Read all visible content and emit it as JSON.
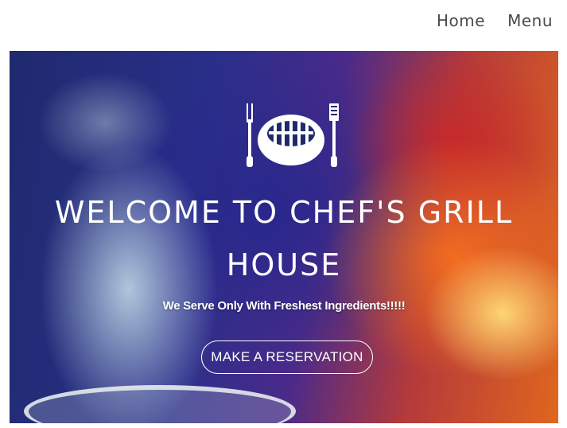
{
  "nav": {
    "items": [
      {
        "label": "Home"
      },
      {
        "label": "Menu"
      }
    ]
  },
  "hero": {
    "logo_icon": "grill-logo-icon",
    "title": "WELCOME TO CHEF'S GRILL HOUSE",
    "subtitle": "We Serve Only With Freshest Ingredients!!!!!",
    "cta_label": "MAKE A RESERVATION"
  }
}
